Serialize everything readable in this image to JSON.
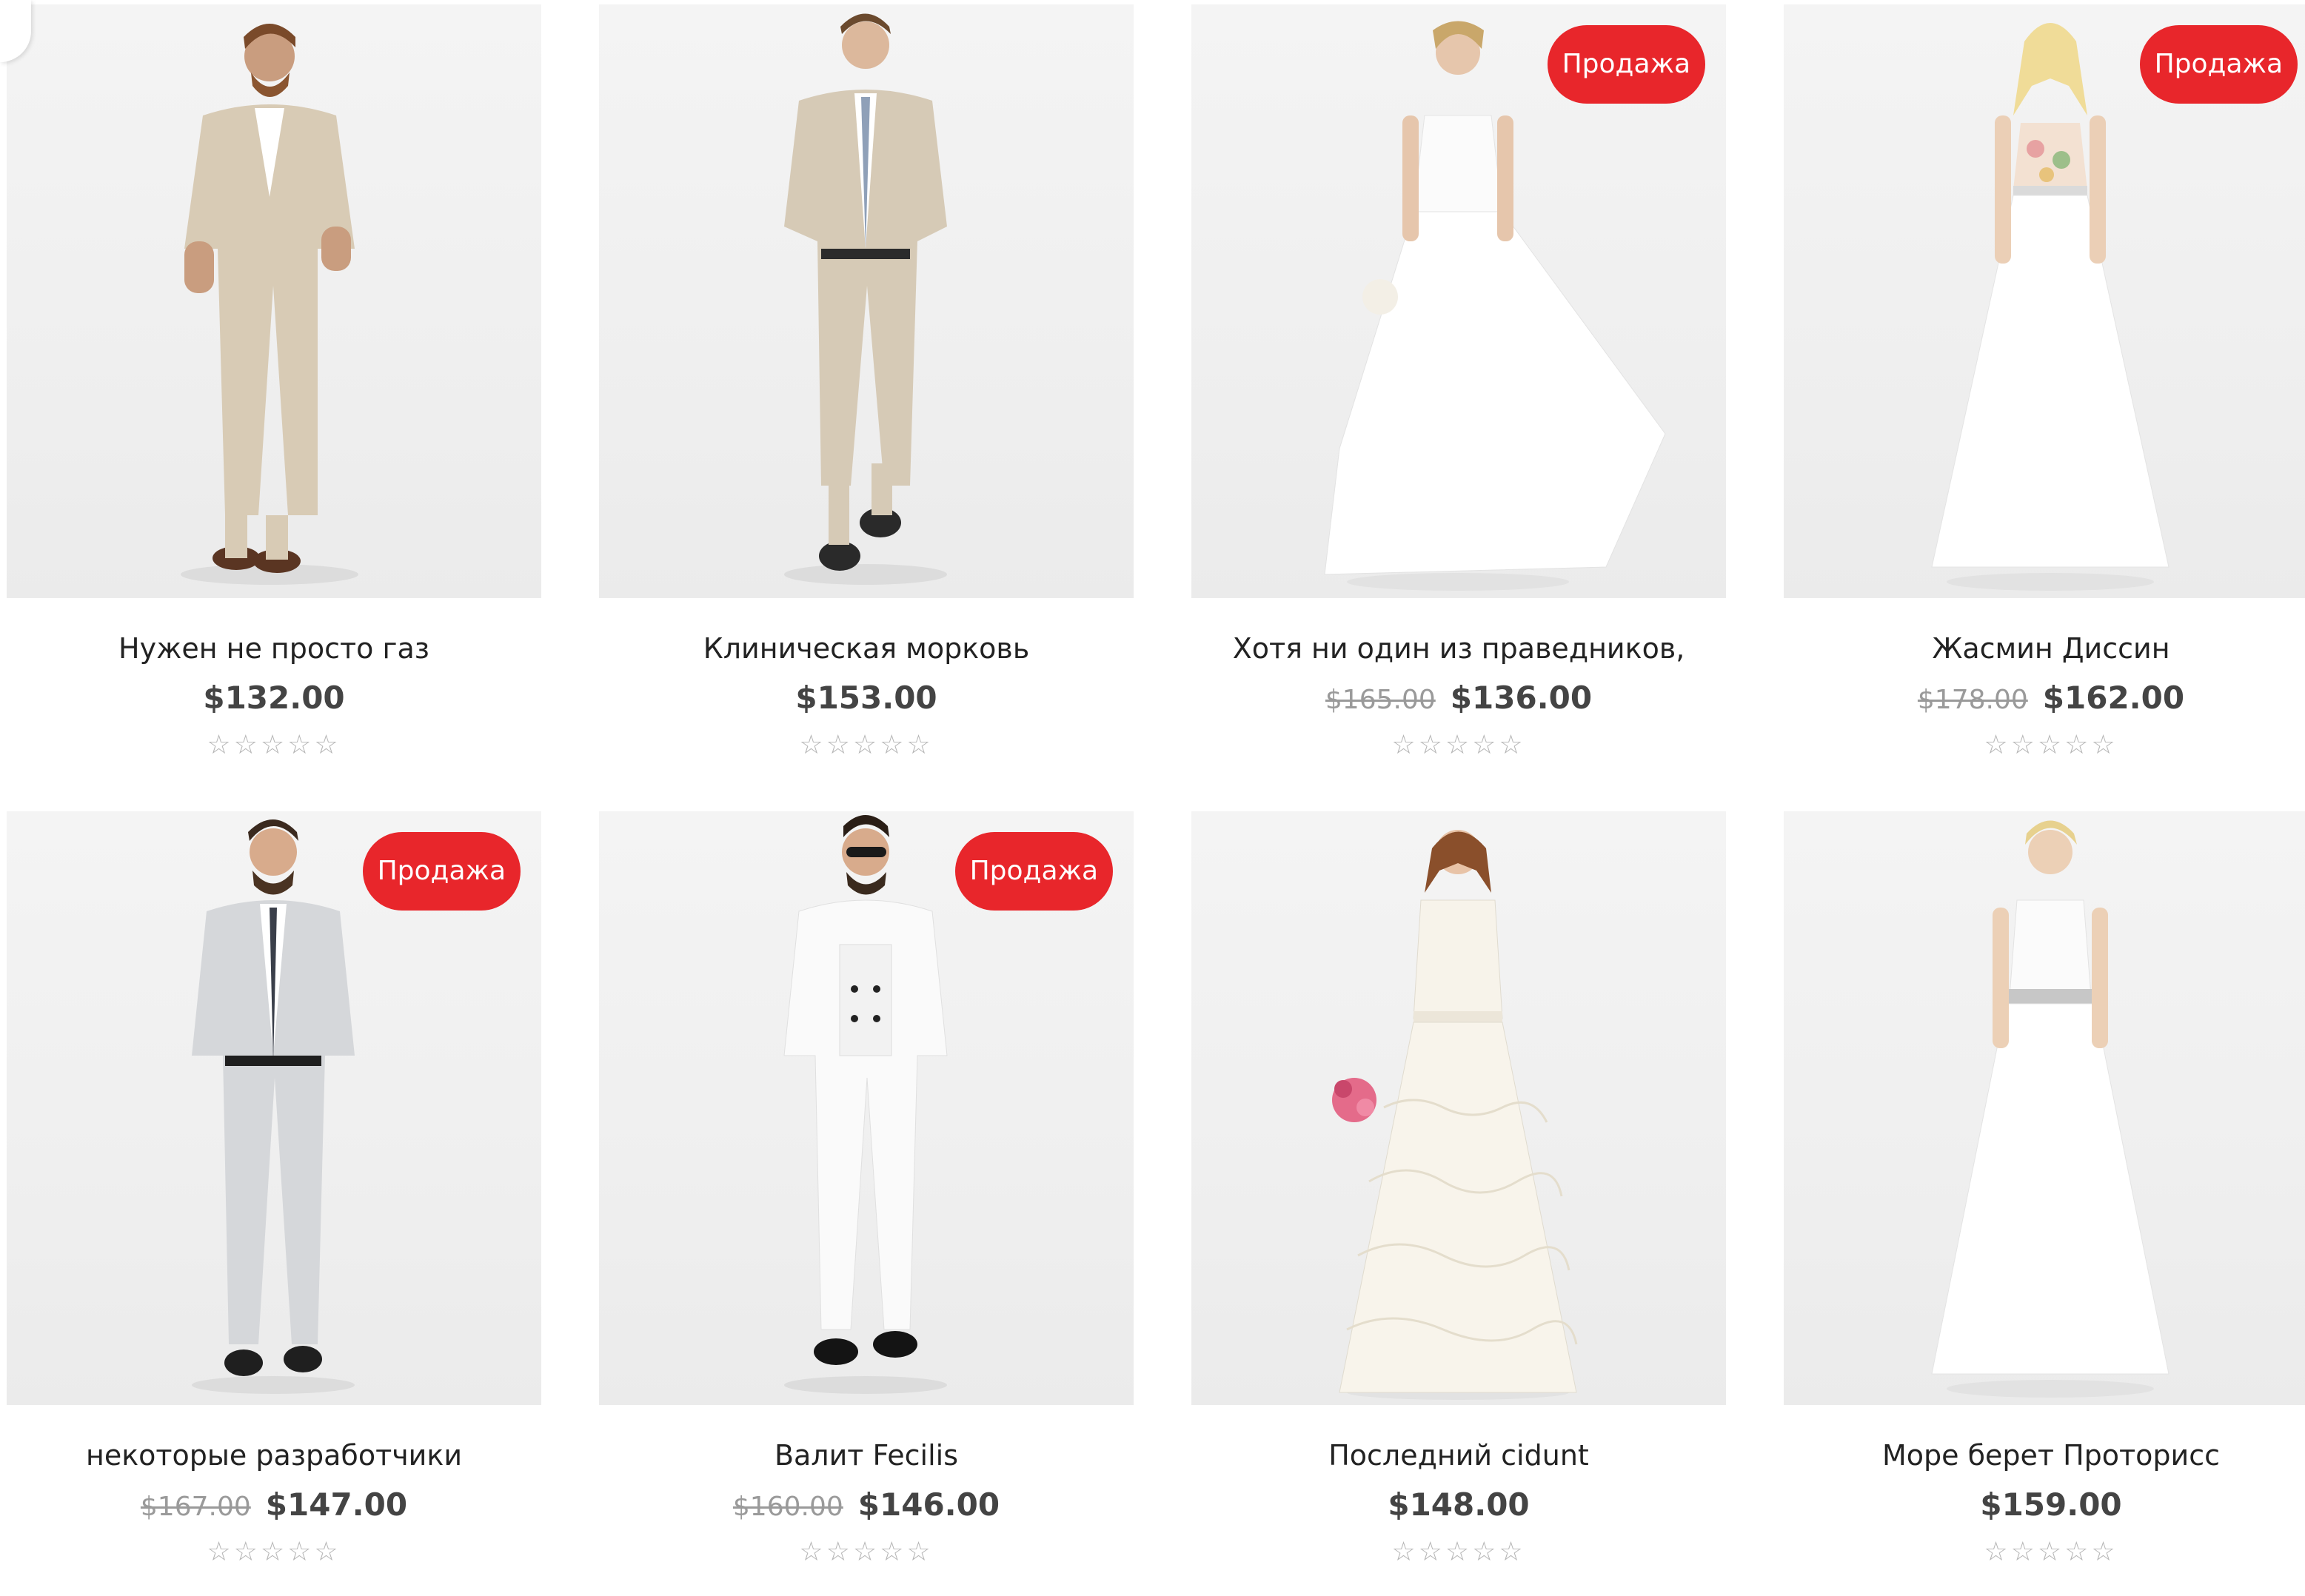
{
  "colors": {
    "sale_badge": "#e8262b",
    "price": "#444444",
    "old_price": "#9a9a9a",
    "stars": "#b5b5b5"
  },
  "products": [
    {
      "title": "Нужен не просто газ",
      "price": "$132.00",
      "old_price": "",
      "badge": "",
      "stars": "☆☆☆☆☆",
      "image": "man-beige-suit",
      "rating": 0
    },
    {
      "title": "Клиническая морковь",
      "price": "$153.00",
      "old_price": "",
      "badge": "",
      "stars": "☆☆☆☆☆",
      "image": "man-beige-suit-tie",
      "rating": 0
    },
    {
      "title": "Хотя ни один из праведников,",
      "price": "$136.00",
      "old_price": "$165.00",
      "badge": "Продажа",
      "stars": "☆☆☆☆☆",
      "image": "woman-white-gown",
      "rating": 0
    },
    {
      "title": "Жасмин Диссин",
      "price": "$162.00",
      "old_price": "$178.00",
      "badge": "Продажа",
      "stars": "☆☆☆☆☆",
      "image": "woman-floral-gown",
      "rating": 0
    },
    {
      "title": "некоторые разработчики",
      "price": "$147.00",
      "old_price": "$167.00",
      "badge": "Продажа",
      "stars": "☆☆☆☆☆",
      "image": "man-grey-suit",
      "rating": 0
    },
    {
      "title": "Валит Fecilis",
      "price": "$146.00",
      "old_price": "$160.00",
      "badge": "Продажа",
      "stars": "☆☆☆☆☆",
      "image": "man-white-suit",
      "rating": 0
    },
    {
      "title": "Последний cidunt",
      "price": "$148.00",
      "old_price": "",
      "badge": "",
      "stars": "☆☆☆☆☆",
      "image": "woman-lace-gown",
      "rating": 0
    },
    {
      "title": "Море берет Проторисс",
      "price": "$159.00",
      "old_price": "",
      "badge": "",
      "stars": "☆☆☆☆☆",
      "image": "woman-white-maxi-dress",
      "rating": 0
    }
  ]
}
